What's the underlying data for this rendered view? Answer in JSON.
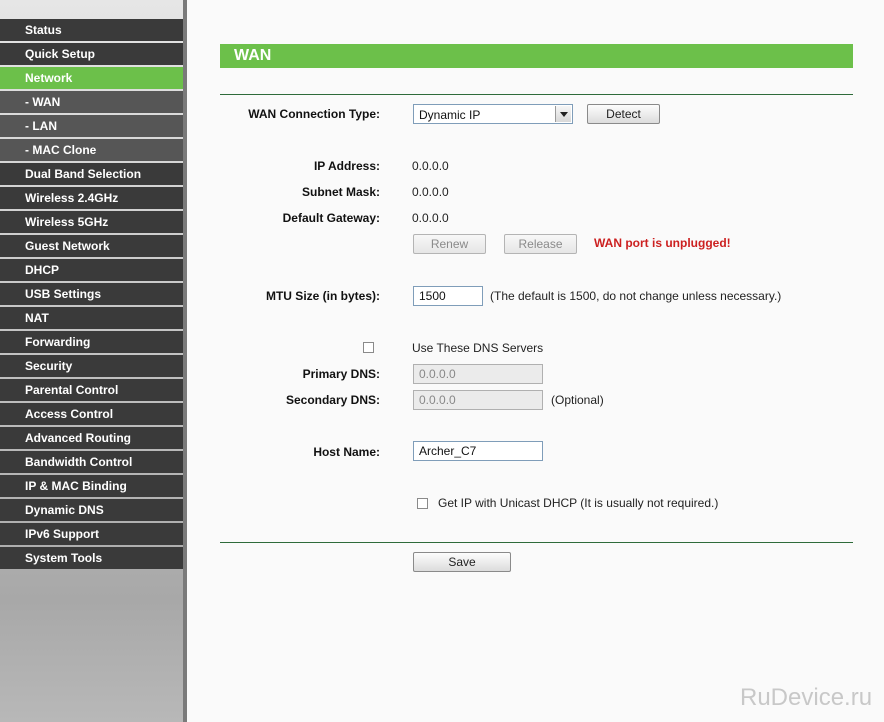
{
  "sidebar": {
    "items": [
      {
        "label": "Status",
        "type": "main",
        "state": "normal"
      },
      {
        "label": "Quick Setup",
        "type": "main",
        "state": "normal"
      },
      {
        "label": "Network",
        "type": "main",
        "state": "active"
      },
      {
        "label": "- WAN",
        "type": "sub",
        "state": "current"
      },
      {
        "label": "- LAN",
        "type": "sub",
        "state": "normal"
      },
      {
        "label": "- MAC Clone",
        "type": "sub",
        "state": "normal"
      },
      {
        "label": "Dual Band Selection",
        "type": "main",
        "state": "normal"
      },
      {
        "label": "Wireless 2.4GHz",
        "type": "main",
        "state": "normal"
      },
      {
        "label": "Wireless 5GHz",
        "type": "main",
        "state": "normal"
      },
      {
        "label": "Guest Network",
        "type": "main",
        "state": "normal"
      },
      {
        "label": "DHCP",
        "type": "main",
        "state": "normal"
      },
      {
        "label": "USB Settings",
        "type": "main",
        "state": "normal"
      },
      {
        "label": "NAT",
        "type": "main",
        "state": "normal"
      },
      {
        "label": "Forwarding",
        "type": "main",
        "state": "normal"
      },
      {
        "label": "Security",
        "type": "main",
        "state": "normal"
      },
      {
        "label": "Parental Control",
        "type": "main",
        "state": "normal"
      },
      {
        "label": "Access Control",
        "type": "main",
        "state": "normal"
      },
      {
        "label": "Advanced Routing",
        "type": "main",
        "state": "normal"
      },
      {
        "label": "Bandwidth Control",
        "type": "main",
        "state": "normal"
      },
      {
        "label": "IP & MAC Binding",
        "type": "main",
        "state": "normal"
      },
      {
        "label": "Dynamic DNS",
        "type": "main",
        "state": "normal"
      },
      {
        "label": "IPv6 Support",
        "type": "main",
        "state": "normal"
      },
      {
        "label": "System Tools",
        "type": "main",
        "state": "normal"
      }
    ]
  },
  "page": {
    "title": "WAN",
    "accent_color": "#6cc04a",
    "warning_color": "#cc2020"
  },
  "form": {
    "wan_type_label": "WAN Connection Type:",
    "wan_type_value": "Dynamic IP",
    "detect_label": "Detect",
    "ip_label": "IP Address:",
    "ip_value": "0.0.0.0",
    "mask_label": "Subnet Mask:",
    "mask_value": "0.0.0.0",
    "gateway_label": "Default Gateway:",
    "gateway_value": "0.0.0.0",
    "renew_label": "Renew",
    "release_label": "Release",
    "warning": "WAN port is unplugged!",
    "mtu_label": "MTU Size (in bytes):",
    "mtu_value": "1500",
    "mtu_hint": "(The default is 1500, do not change unless necessary.)",
    "dns_checkbox_label": "Use These DNS Servers",
    "dns_checked": false,
    "primary_dns_label": "Primary DNS:",
    "primary_dns_value": "0.0.0.0",
    "secondary_dns_label": "Secondary DNS:",
    "secondary_dns_value": "0.0.0.0",
    "optional_label": "(Optional)",
    "host_label": "Host Name:",
    "host_value": "Archer_C7",
    "unicast_label": "Get IP with Unicast DHCP (It is usually not required.)",
    "unicast_checked": false,
    "save_label": "Save"
  },
  "watermark": "RuDevice.ru"
}
